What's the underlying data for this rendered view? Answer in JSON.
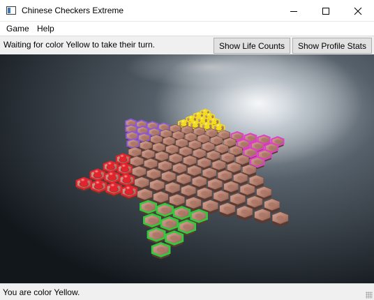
{
  "window": {
    "title": "Chinese Checkers Extreme",
    "controls": {
      "minimize": "minimize-icon",
      "maximize": "maximize-icon",
      "close": "close-icon"
    }
  },
  "menu": {
    "items": [
      "Game",
      "Help"
    ]
  },
  "toolbar": {
    "status": "Waiting for color Yellow to take their turn.",
    "life_counts_label": "Show Life Counts",
    "profile_stats_label": "Show Profile Stats"
  },
  "statusbar": {
    "text": "You are color Yellow."
  },
  "board": {
    "player_colors": {
      "Yellow": "#f2dc1c",
      "Purple": "#8a5ad6",
      "Pink": "#e040c8",
      "Red": "#e4242c",
      "Green": "#34c83c"
    },
    "occupied_corners": [
      "Yellow",
      "Red"
    ]
  }
}
